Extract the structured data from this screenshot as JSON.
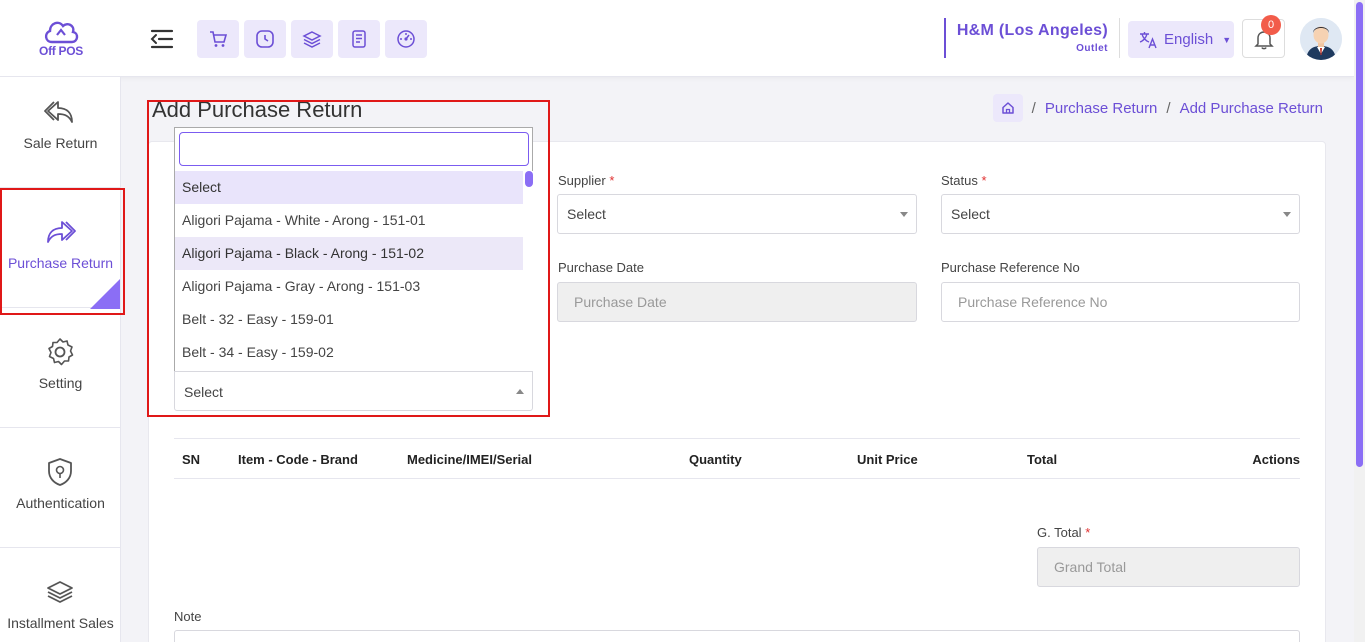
{
  "app": {
    "logo_text": "Off POS"
  },
  "header": {
    "quick_actions": [
      "cart-icon",
      "clock-icon",
      "layers-icon",
      "receipt-icon",
      "dashboard-icon"
    ],
    "outlet_name": "H&M (Los Angeles)",
    "outlet_type": "Outlet",
    "language": "English",
    "notification_count": "0"
  },
  "sidebar": {
    "items": [
      {
        "label": "Sale Return",
        "icon": "reply-all-icon",
        "active": false
      },
      {
        "label": "Purchase Return",
        "icon": "forward-all-icon",
        "active": true
      },
      {
        "label": "Setting",
        "icon": "gear-icon",
        "active": false
      },
      {
        "label": "Authentication",
        "icon": "shield-key-icon",
        "active": false
      },
      {
        "label": "Installment Sales",
        "icon": "layers-icon",
        "active": false
      }
    ]
  },
  "page": {
    "title": "Add Purchase Return",
    "breadcrumb": [
      "Purchase Return",
      "Add Purchase Return"
    ]
  },
  "form": {
    "supplier_label": "Supplier",
    "supplier_value": "Select",
    "status_label": "Status",
    "status_value": "Select",
    "purchase_date_label": "Purchase Date",
    "purchase_date_placeholder": "Purchase Date",
    "purchase_ref_label": "Purchase Reference No",
    "purchase_ref_placeholder": "Purchase Reference No",
    "item_select_value": "Select",
    "grand_total_label": "G. Total",
    "grand_total_placeholder": "Grand Total",
    "note_label": "Note",
    "required_mark": "*"
  },
  "dropdown": {
    "search_value": "",
    "options": [
      "Select",
      "Aligori Pajama - White - Arong - 151-01",
      "Aligori Pajama - Black - Arong - 151-02",
      "Aligori Pajama - Gray - Arong - 151-03",
      "Belt - 32 - Easy - 159-01",
      "Belt - 34 - Easy - 159-02"
    ],
    "selected_index": 0,
    "hovered_index": 2
  },
  "table": {
    "headers": [
      "SN",
      "Item - Code - Brand",
      "Medicine/IMEI/Serial",
      "Quantity",
      "Unit Price",
      "Total",
      "Actions"
    ]
  },
  "colors": {
    "accent": "#6c4fd6",
    "accent_light": "#ece8fb",
    "highlight_border": "#e01818",
    "badge": "#f25c4a"
  }
}
